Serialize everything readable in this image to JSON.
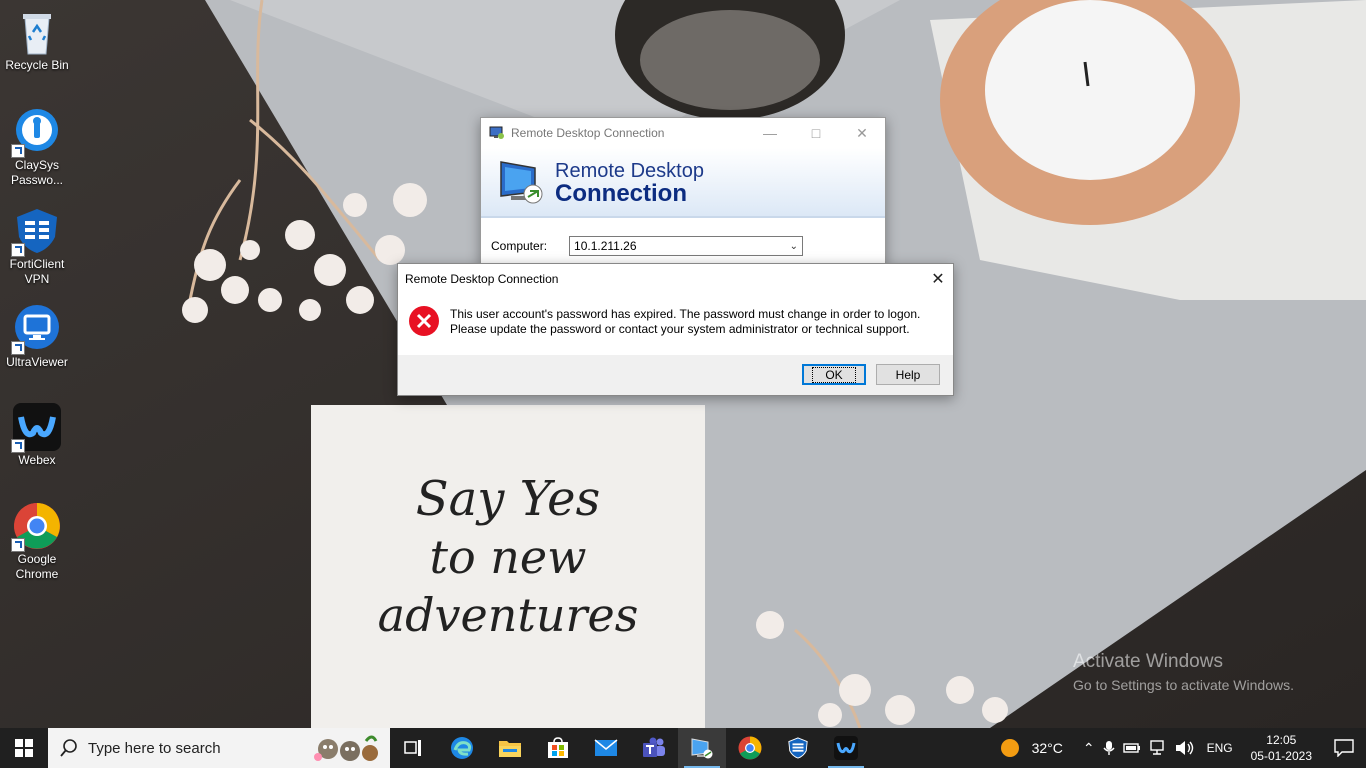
{
  "desktop": {
    "icons": [
      {
        "label": "Recycle Bin",
        "icon": "recycle-bin-icon"
      },
      {
        "label": "ClaySys Passwo...",
        "icon": "claysys-password-icon"
      },
      {
        "label": "FortiClient VPN",
        "icon": "forticlient-vpn-icon"
      },
      {
        "label": "UltraViewer",
        "icon": "ultraviewer-icon"
      },
      {
        "label": "Webex",
        "icon": "webex-icon"
      },
      {
        "label": "Google Chrome",
        "icon": "chrome-icon"
      }
    ],
    "wallpaper_card": {
      "line1": "Say Yes",
      "line2": "to new",
      "line3": "adventures"
    },
    "watermark": {
      "title": "Activate Windows",
      "subtitle": "Go to Settings to activate Windows."
    }
  },
  "rdc_window": {
    "title": "Remote Desktop Connection",
    "banner_line1": "Remote Desktop",
    "banner_line2": "Connection",
    "computer_label": "Computer:",
    "computer_value": "10.1.211.26"
  },
  "error_dialog": {
    "title": "Remote Desktop Connection",
    "message_line1": "This user account's password has expired. The password must change in order to logon.",
    "message_line2": "Please update the password or contact your system administrator or technical support.",
    "ok_label": "OK",
    "help_label": "Help"
  },
  "taskbar": {
    "search_placeholder": "Type here to search",
    "pinned": [
      "task-view-icon",
      "edge-icon",
      "file-explorer-icon",
      "microsoft-store-icon",
      "mail-icon",
      "teams-icon",
      "remote-desktop-icon",
      "chrome-icon",
      "forticlient-icon",
      "webex-icon"
    ],
    "weather_temp": "32°C",
    "language": "ENG",
    "time": "12:05",
    "date": "05-01-2023"
  },
  "colors": {
    "taskbar": "#202020",
    "accent": "#0078d7",
    "error_red": "#e81123",
    "banner_text": "#0c2c80"
  }
}
